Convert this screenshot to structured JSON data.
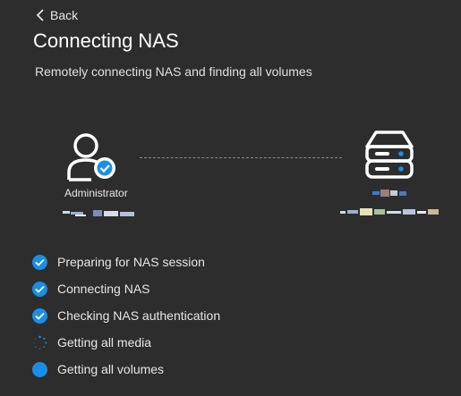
{
  "header": {
    "back_label": "Back",
    "title": "Connecting NAS",
    "subtitle": "Remotely connecting NAS and finding all volumes"
  },
  "connection": {
    "user_label": "Administrator",
    "user_icon": "user-check-icon",
    "server_icon": "nas-server-icon"
  },
  "steps": [
    {
      "label": "Preparing for NAS session",
      "status": "done"
    },
    {
      "label": "Connecting NAS",
      "status": "done"
    },
    {
      "label": "Checking NAS authentication",
      "status": "done"
    },
    {
      "label": "Getting all media",
      "status": "in-progress"
    },
    {
      "label": "Getting all volumes",
      "status": "pending"
    }
  ],
  "colors": {
    "background": "#2d2d2d",
    "accent": "#1a8ee6",
    "text": "#e6e6e6"
  }
}
